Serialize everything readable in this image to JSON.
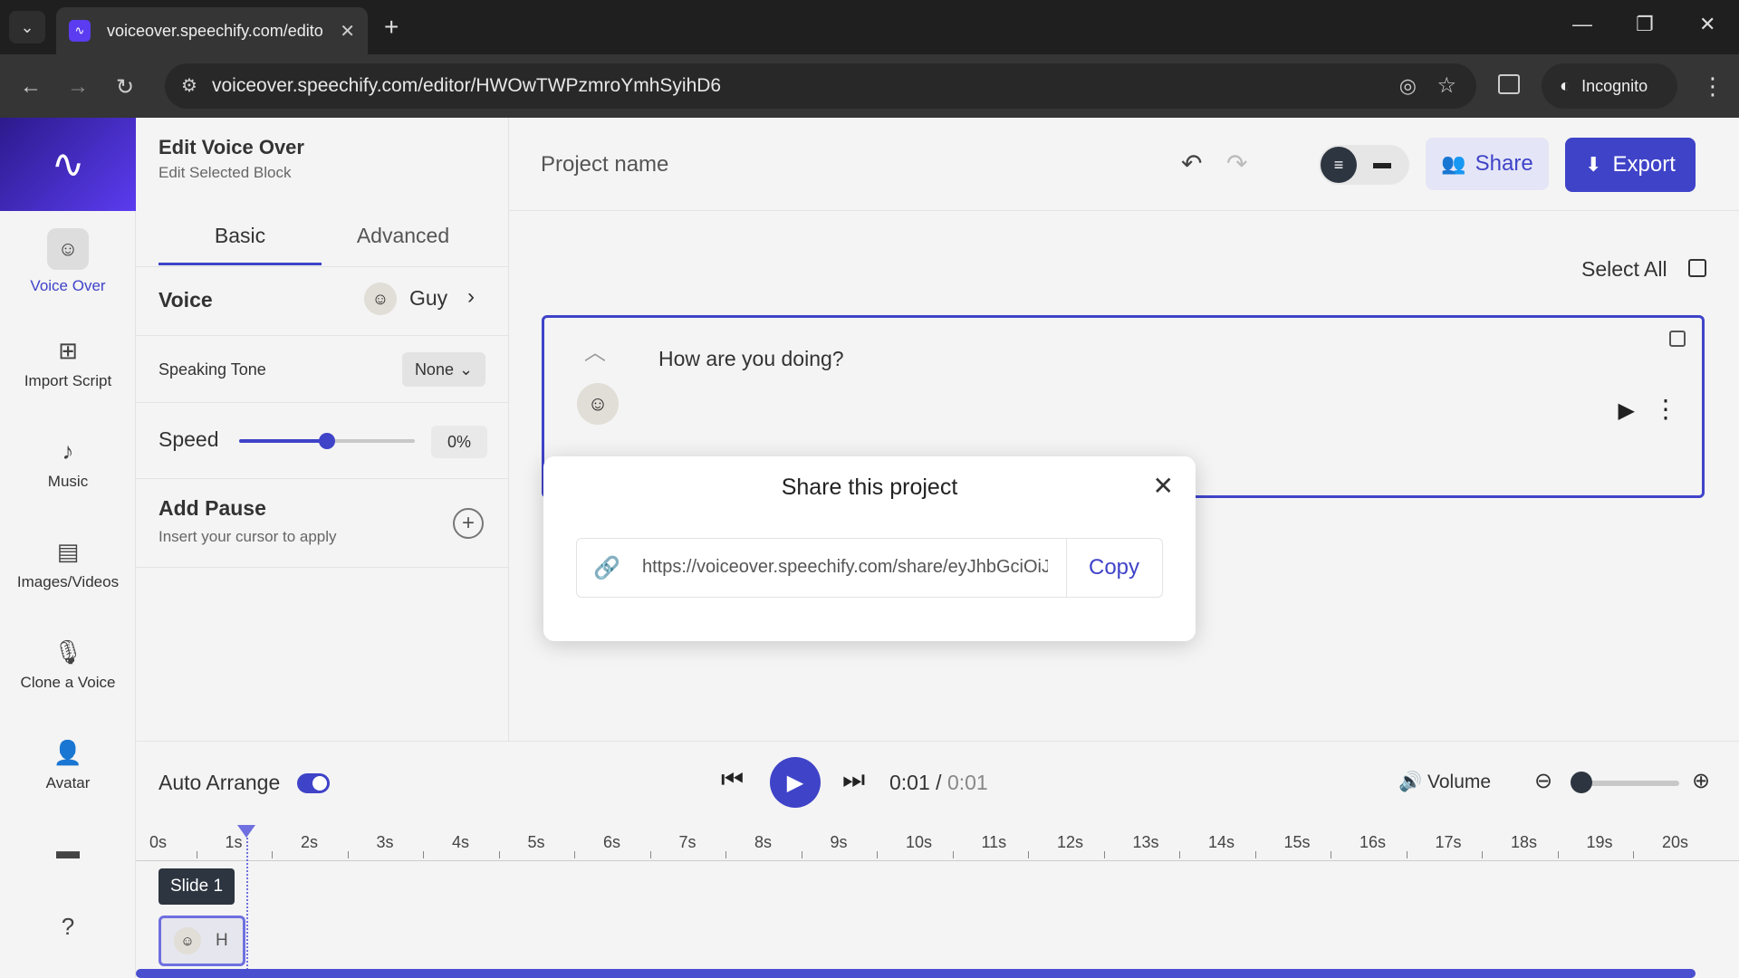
{
  "browser": {
    "tab_title": "voiceover.speechify.com/edito",
    "url": "voiceover.speechify.com/editor/HWOwTWPzmroYmhSyihD6",
    "incognito_label": "Incognito"
  },
  "app": {
    "panel_title": "Edit Voice Over",
    "panel_subtitle": "Edit Selected Block",
    "rail": [
      {
        "label": "Voice Over"
      },
      {
        "label": "Import Script"
      },
      {
        "label": "Music"
      },
      {
        "label": "Images/Videos"
      },
      {
        "label": "Clone a Voice"
      },
      {
        "label": "Avatar"
      }
    ],
    "tabs": {
      "basic": "Basic",
      "advanced": "Advanced"
    },
    "voice": {
      "label": "Voice",
      "name": "Guy"
    },
    "speaking_tone": {
      "label": "Speaking Tone",
      "value": "None"
    },
    "speed": {
      "label": "Speed",
      "value": "0%",
      "level": 0.5
    },
    "add_pause": {
      "title": "Add Pause",
      "subtitle": "Insert your cursor to apply"
    },
    "header": {
      "project_name": "Project name",
      "share_label": "Share",
      "export_label": "Export"
    },
    "select_all": "Select All",
    "block_text": "How are you doing?",
    "player": {
      "auto_arrange": "Auto Arrange",
      "time_current": "0:01",
      "time_sep": " / ",
      "time_total": "0:01",
      "volume": "Volume",
      "zoom_level": 0.05
    },
    "timeline": {
      "ticks": [
        "0s",
        "1s",
        "2s",
        "3s",
        "4s",
        "5s",
        "6s",
        "7s",
        "8s",
        "9s",
        "10s",
        "11s",
        "12s",
        "13s",
        "14s",
        "15s",
        "16s",
        "17s",
        "18s",
        "19s",
        "20s"
      ],
      "slide_label": "Slide 1",
      "clip_label": "H"
    }
  },
  "modal": {
    "title": "Share this project",
    "share_url": "https://voiceover.speechify.com/share/eyJhbGciOiJ",
    "copy_label": "Copy"
  },
  "colors": {
    "accent": "#3f43c8",
    "playhead": "#6f6fe0"
  }
}
